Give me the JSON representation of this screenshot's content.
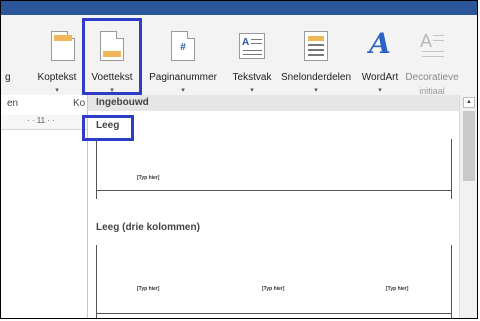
{
  "ribbon": {
    "partial_left_label": "g",
    "koptekst_label": "Koptekst",
    "voettekst_label": "Voettekst",
    "paginanummer_label": "Paginanummer",
    "tekstvak_label": "Tekstvak",
    "snelonderdelen_label": "Snelonderdelen",
    "wordart_label": "WordArt",
    "decoratieve_line1": "Decoratieve",
    "decoratieve_line2": "initiaal",
    "dropdown_glyph": "▾"
  },
  "left": {
    "section_fragment": "en",
    "section_fragment2": "Ko",
    "ruler_marks": "·  ·  11  ·  ·"
  },
  "panel": {
    "header": "Ingebouwd",
    "category_1": "Leeg",
    "category_2": "Leeg (drie kolommen)",
    "placeholder": "[Typ hier]"
  },
  "colors": {
    "highlight": "#2f3dc4",
    "accent": "#2b579a"
  }
}
